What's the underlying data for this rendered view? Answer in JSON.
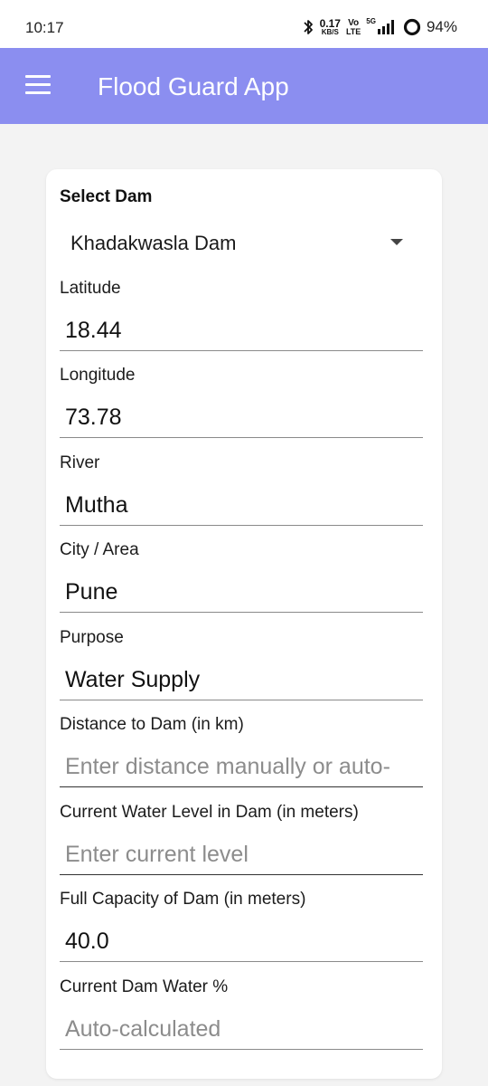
{
  "status_bar": {
    "time": "10:17",
    "speed_value": "0.17",
    "speed_unit": "KB/S",
    "volte_top": "Vo",
    "volte_bottom": "LTE",
    "network": "5G",
    "battery": "94%",
    "icons": [
      "bluetooth-icon",
      "signal-icon",
      "battery-icon"
    ]
  },
  "app_bar": {
    "title": "Flood Guard App",
    "menu_icon": "hamburger-menu-icon",
    "color": "#8b8ef0"
  },
  "form": {
    "dam_section_title": "Select Dam",
    "selected_dam": "Khadakwasla Dam",
    "fields": {
      "latitude": {
        "label": "Latitude",
        "value": "18.44"
      },
      "longitude": {
        "label": "Longitude",
        "value": "73.78"
      },
      "river": {
        "label": "River",
        "value": "Mutha"
      },
      "city": {
        "label": "City / Area",
        "value": "Pune"
      },
      "purpose": {
        "label": "Purpose",
        "value": "Water Supply"
      },
      "distance": {
        "label": "Distance to Dam (in km)",
        "placeholder": "Enter distance manually or auto-"
      },
      "current_level": {
        "label": "Current Water Level in Dam (in meters)",
        "placeholder": "Enter current level"
      },
      "full_capacity": {
        "label": "Full Capacity of Dam (in meters)",
        "value": "40.0"
      },
      "water_percent": {
        "label": "Current Dam Water %",
        "placeholder": "Auto-calculated"
      }
    }
  }
}
